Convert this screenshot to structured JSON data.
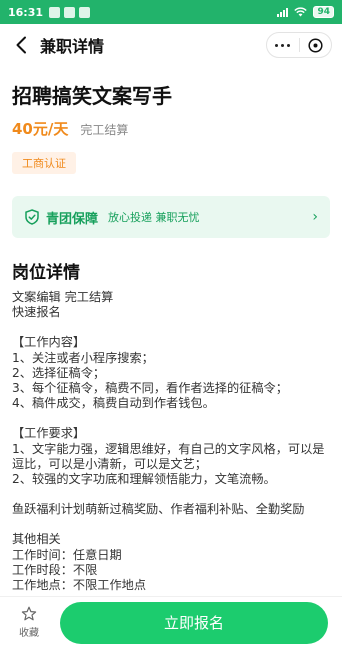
{
  "status_bar": {
    "time": "16:31",
    "battery": "94"
  },
  "nav": {
    "title": "兼职详情"
  },
  "job": {
    "title": "招聘搞笑文案写手",
    "salary": "40元/天",
    "settlement": "完工结算",
    "badge": "工商认证"
  },
  "guarantee": {
    "title": "青团保障",
    "subtitle": "放心投递 兼职无忧"
  },
  "section": {
    "title": "岗位详情"
  },
  "detail_lines": [
    "文案编辑 完工结算",
    "快速报名",
    "",
    "【工作内容】",
    "1、关注或者小程序搜索；",
    "2、选择征稿令；",
    "3、每个征稿令，稿费不同，看作者选择的征稿令；",
    "4、稿件成交，稿费自动到作者钱包。",
    "",
    "【工作要求】",
    "1、文字能力强，逻辑思维好，有自己的文字风格，可以是逗比，可以是小清新，可以是文艺；",
    "2、较强的文字功底和理解领悟能力，文笔流畅。",
    "",
    "鱼跃福利计划萌新过稿奖励、作者福利补贴、全勤奖励",
    "",
    "其他相关",
    "工作时间：任意日期",
    "工作时段：不限",
    "工作地点：不限工作地点"
  ],
  "bottom": {
    "favorite_label": "收藏",
    "apply_label": "立即报名"
  },
  "colors": {
    "status_bar": "#22b36b",
    "accent_orange": "#f08a1c",
    "guarantee_green": "#17a05c",
    "apply_button": "#1ccc6e"
  },
  "icons": {
    "back": "back-arrow-icon",
    "more": "more-dots-icon",
    "close": "close-circle-icon",
    "shield": "shield-check-icon",
    "chevron": "chevron-right-icon",
    "star": "star-outline-icon"
  }
}
